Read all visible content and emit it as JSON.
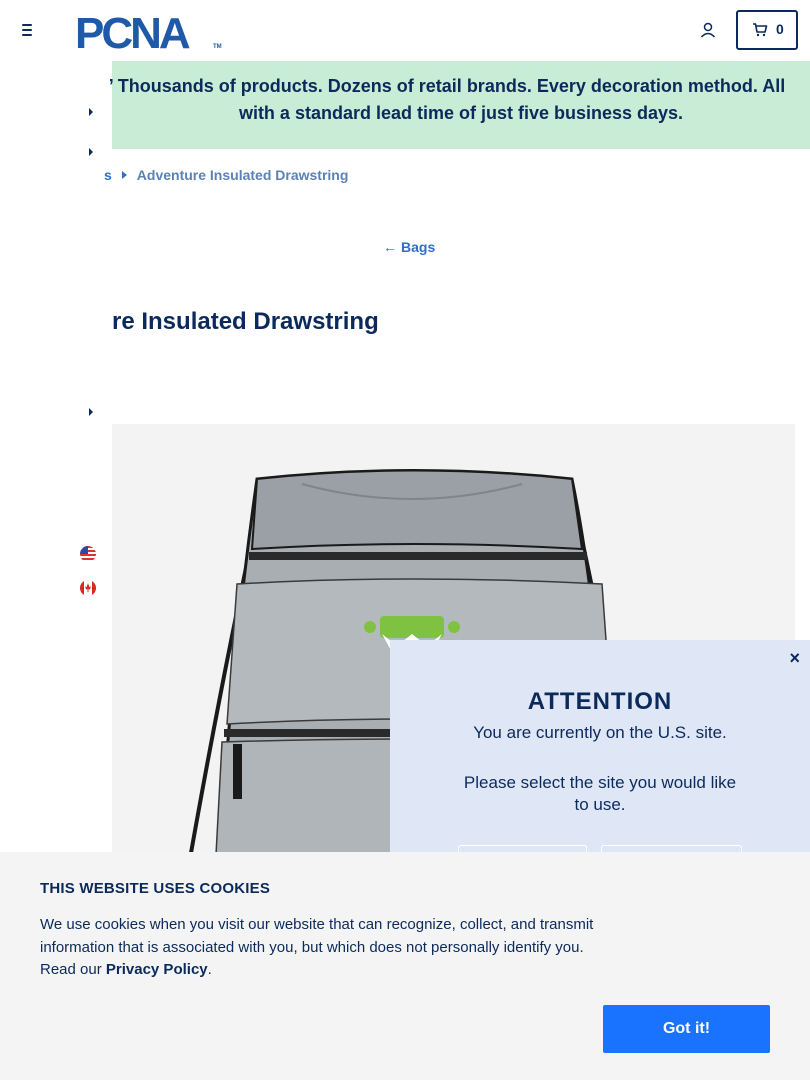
{
  "header": {
    "logo_text": "PCNA",
    "logo_tm": "TM",
    "cart_count": "0"
  },
  "banner": {
    "line1": "’ Thousands of products. Dozens of retail brands. Every decoration method. All",
    "line2": "with a standard lead time of just five business days."
  },
  "breadcrumb": {
    "parent": "s",
    "current": "Adventure Insulated Drawstring"
  },
  "back_link": {
    "label": "Bags",
    "arrow": "←"
  },
  "product": {
    "title": "re Insulated Drawstring",
    "colors": {
      "bag": "#a9aeb3",
      "logo": "#7fc241"
    }
  },
  "attention": {
    "close": "×",
    "title": "ATTENTION",
    "message": "You are currently on the U.S. site.",
    "question": "Please select the site you would like to use."
  },
  "cookie": {
    "title": "THIS WEBSITE USES COOKIES",
    "text": "We use cookies when you visit our website that can recognize, collect, and transmit information that is associated with you, but which does not personally identify you. Read our",
    "link": "Privacy Policy",
    "period": ".",
    "button": "Got it!"
  },
  "colors": {
    "navy": "#0b2a5b",
    "banner_bg": "#c8ecd5",
    "accent_blue": "#1a73ff",
    "modal_bg": "#dfe7f6"
  }
}
